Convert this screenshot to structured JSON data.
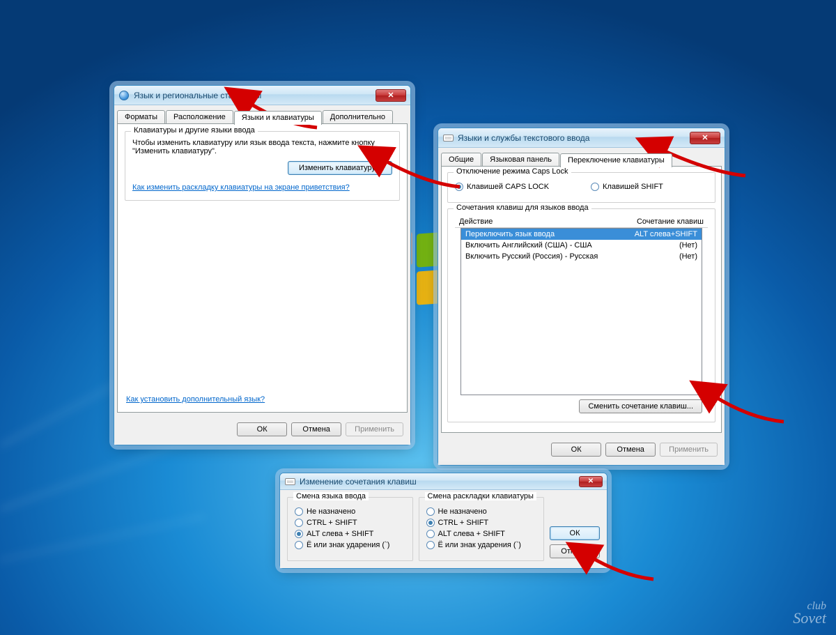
{
  "dialog1": {
    "title": "Язык и региональные стандарты",
    "tabs": [
      "Форматы",
      "Расположение",
      "Языки и клавиатуры",
      "Дополнительно"
    ],
    "active_tab": 2,
    "group_title": "Клавиатуры и другие языки ввода",
    "group_text1": "Чтобы изменить клавиатуру или язык ввода текста, нажмите кнопку",
    "group_text2": "\"Изменить клавиатуру\".",
    "change_keyboard_btn": "Изменить клавиатуру...",
    "link1": "Как изменить раскладку клавиатуры на экране приветствия?",
    "link2": "Как установить дополнительный язык?",
    "ok": "ОК",
    "cancel": "Отмена",
    "apply": "Применить"
  },
  "dialog2": {
    "title": "Языки и службы текстового ввода",
    "tabs": [
      "Общие",
      "Языковая панель",
      "Переключение клавиатуры"
    ],
    "active_tab": 2,
    "caps_group": "Отключение режима Caps Lock",
    "caps_opt1": "Клавишей CAPS LOCK",
    "caps_opt2": "Клавишей SHIFT",
    "hotkeys_group": "Сочетания клавиш для языков ввода",
    "col_action": "Действие",
    "col_combo": "Сочетание клавиш",
    "rows": [
      {
        "action": "Переключить язык ввода",
        "combo": "ALT слева+SHIFT",
        "selected": true
      },
      {
        "action": "Включить Английский (США) - США",
        "combo": "(Нет)",
        "selected": false
      },
      {
        "action": "Включить Русский (Россия) - Русская",
        "combo": "(Нет)",
        "selected": false
      }
    ],
    "change_combo_btn": "Сменить сочетание клавиш...",
    "ok": "ОК",
    "cancel": "Отмена",
    "apply": "Применить"
  },
  "dialog3": {
    "title": "Изменение сочетания клавиш",
    "left_group": "Смена языка ввода",
    "right_group": "Смена раскладки клавиатуры",
    "opt_none": "Не назначено",
    "opt_ctrl_shift": "CTRL + SHIFT",
    "opt_alt_shift": "ALT слева + SHIFT",
    "opt_grave": "Ё или знак ударения (`)",
    "ok": "ОК",
    "cancel": "Отмена"
  },
  "watermark": {
    "top": "club",
    "bottom": "Sovet"
  }
}
